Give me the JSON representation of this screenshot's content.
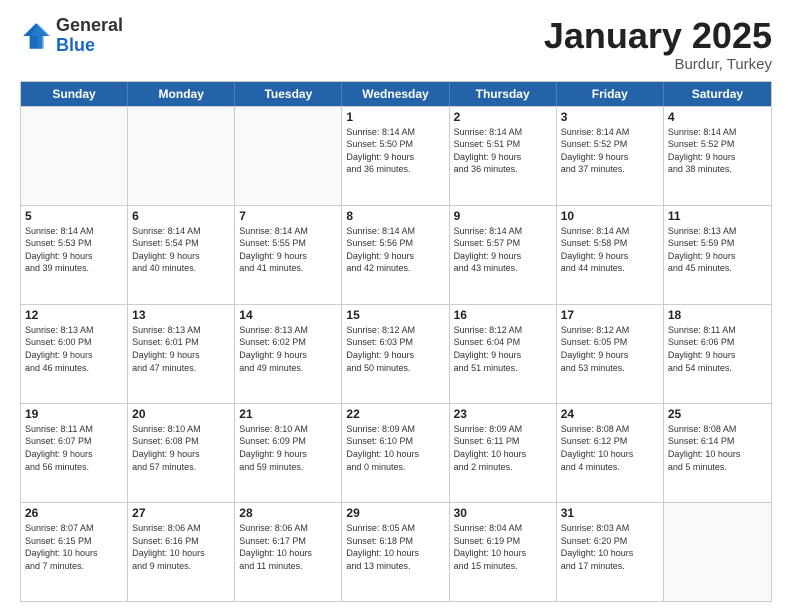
{
  "logo": {
    "general": "General",
    "blue": "Blue"
  },
  "title": {
    "month": "January 2025",
    "location": "Burdur, Turkey"
  },
  "header_days": [
    "Sunday",
    "Monday",
    "Tuesday",
    "Wednesday",
    "Thursday",
    "Friday",
    "Saturday"
  ],
  "weeks": [
    [
      {
        "day": "",
        "info": ""
      },
      {
        "day": "",
        "info": ""
      },
      {
        "day": "",
        "info": ""
      },
      {
        "day": "1",
        "info": "Sunrise: 8:14 AM\nSunset: 5:50 PM\nDaylight: 9 hours\nand 36 minutes."
      },
      {
        "day": "2",
        "info": "Sunrise: 8:14 AM\nSunset: 5:51 PM\nDaylight: 9 hours\nand 36 minutes."
      },
      {
        "day": "3",
        "info": "Sunrise: 8:14 AM\nSunset: 5:52 PM\nDaylight: 9 hours\nand 37 minutes."
      },
      {
        "day": "4",
        "info": "Sunrise: 8:14 AM\nSunset: 5:52 PM\nDaylight: 9 hours\nand 38 minutes."
      }
    ],
    [
      {
        "day": "5",
        "info": "Sunrise: 8:14 AM\nSunset: 5:53 PM\nDaylight: 9 hours\nand 39 minutes."
      },
      {
        "day": "6",
        "info": "Sunrise: 8:14 AM\nSunset: 5:54 PM\nDaylight: 9 hours\nand 40 minutes."
      },
      {
        "day": "7",
        "info": "Sunrise: 8:14 AM\nSunset: 5:55 PM\nDaylight: 9 hours\nand 41 minutes."
      },
      {
        "day": "8",
        "info": "Sunrise: 8:14 AM\nSunset: 5:56 PM\nDaylight: 9 hours\nand 42 minutes."
      },
      {
        "day": "9",
        "info": "Sunrise: 8:14 AM\nSunset: 5:57 PM\nDaylight: 9 hours\nand 43 minutes."
      },
      {
        "day": "10",
        "info": "Sunrise: 8:14 AM\nSunset: 5:58 PM\nDaylight: 9 hours\nand 44 minutes."
      },
      {
        "day": "11",
        "info": "Sunrise: 8:13 AM\nSunset: 5:59 PM\nDaylight: 9 hours\nand 45 minutes."
      }
    ],
    [
      {
        "day": "12",
        "info": "Sunrise: 8:13 AM\nSunset: 6:00 PM\nDaylight: 9 hours\nand 46 minutes."
      },
      {
        "day": "13",
        "info": "Sunrise: 8:13 AM\nSunset: 6:01 PM\nDaylight: 9 hours\nand 47 minutes."
      },
      {
        "day": "14",
        "info": "Sunrise: 8:13 AM\nSunset: 6:02 PM\nDaylight: 9 hours\nand 49 minutes."
      },
      {
        "day": "15",
        "info": "Sunrise: 8:12 AM\nSunset: 6:03 PM\nDaylight: 9 hours\nand 50 minutes."
      },
      {
        "day": "16",
        "info": "Sunrise: 8:12 AM\nSunset: 6:04 PM\nDaylight: 9 hours\nand 51 minutes."
      },
      {
        "day": "17",
        "info": "Sunrise: 8:12 AM\nSunset: 6:05 PM\nDaylight: 9 hours\nand 53 minutes."
      },
      {
        "day": "18",
        "info": "Sunrise: 8:11 AM\nSunset: 6:06 PM\nDaylight: 9 hours\nand 54 minutes."
      }
    ],
    [
      {
        "day": "19",
        "info": "Sunrise: 8:11 AM\nSunset: 6:07 PM\nDaylight: 9 hours\nand 56 minutes."
      },
      {
        "day": "20",
        "info": "Sunrise: 8:10 AM\nSunset: 6:08 PM\nDaylight: 9 hours\nand 57 minutes."
      },
      {
        "day": "21",
        "info": "Sunrise: 8:10 AM\nSunset: 6:09 PM\nDaylight: 9 hours\nand 59 minutes."
      },
      {
        "day": "22",
        "info": "Sunrise: 8:09 AM\nSunset: 6:10 PM\nDaylight: 10 hours\nand 0 minutes."
      },
      {
        "day": "23",
        "info": "Sunrise: 8:09 AM\nSunset: 6:11 PM\nDaylight: 10 hours\nand 2 minutes."
      },
      {
        "day": "24",
        "info": "Sunrise: 8:08 AM\nSunset: 6:12 PM\nDaylight: 10 hours\nand 4 minutes."
      },
      {
        "day": "25",
        "info": "Sunrise: 8:08 AM\nSunset: 6:14 PM\nDaylight: 10 hours\nand 5 minutes."
      }
    ],
    [
      {
        "day": "26",
        "info": "Sunrise: 8:07 AM\nSunset: 6:15 PM\nDaylight: 10 hours\nand 7 minutes."
      },
      {
        "day": "27",
        "info": "Sunrise: 8:06 AM\nSunset: 6:16 PM\nDaylight: 10 hours\nand 9 minutes."
      },
      {
        "day": "28",
        "info": "Sunrise: 8:06 AM\nSunset: 6:17 PM\nDaylight: 10 hours\nand 11 minutes."
      },
      {
        "day": "29",
        "info": "Sunrise: 8:05 AM\nSunset: 6:18 PM\nDaylight: 10 hours\nand 13 minutes."
      },
      {
        "day": "30",
        "info": "Sunrise: 8:04 AM\nSunset: 6:19 PM\nDaylight: 10 hours\nand 15 minutes."
      },
      {
        "day": "31",
        "info": "Sunrise: 8:03 AM\nSunset: 6:20 PM\nDaylight: 10 hours\nand 17 minutes."
      },
      {
        "day": "",
        "info": ""
      }
    ]
  ]
}
